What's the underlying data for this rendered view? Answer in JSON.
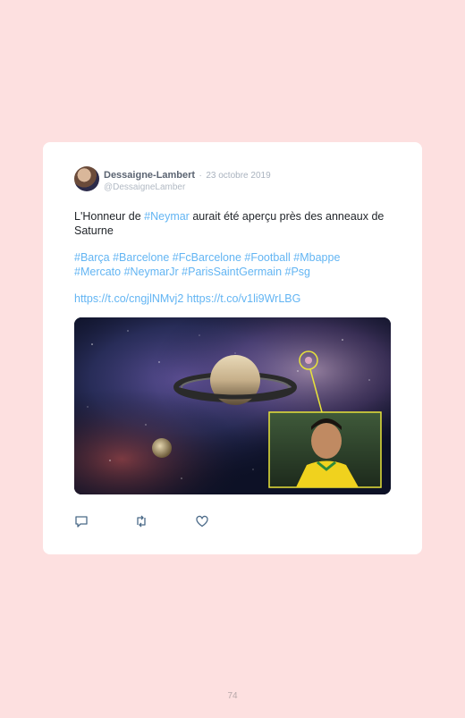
{
  "tweet": {
    "author_name": "Dessaigne-Lambert",
    "separator": "·",
    "date": "23 octobre 2019",
    "handle": "@DessaigneLamber",
    "text_before": "L'Honneur de ",
    "mention": "#Neymar",
    "text_after": " aurait été aperçu près des anneaux de Saturne",
    "hashtags_line1": "#Barça #Barcelone #FcBarcelone #Football #Mbappe",
    "hashtags_line2": "#Mercato #NeymarJr #ParisSaintGermain #Psg",
    "links": "https://t.co/cngjlNMvj2 https://t.co/v1li9WrLBG",
    "actions": [
      "reply-icon",
      "retweet-icon",
      "like-icon"
    ]
  },
  "page": {
    "number": "74"
  },
  "colors": {
    "background": "#fde0e0",
    "link": "#63b5f3",
    "highlight": "#e8e33a"
  }
}
